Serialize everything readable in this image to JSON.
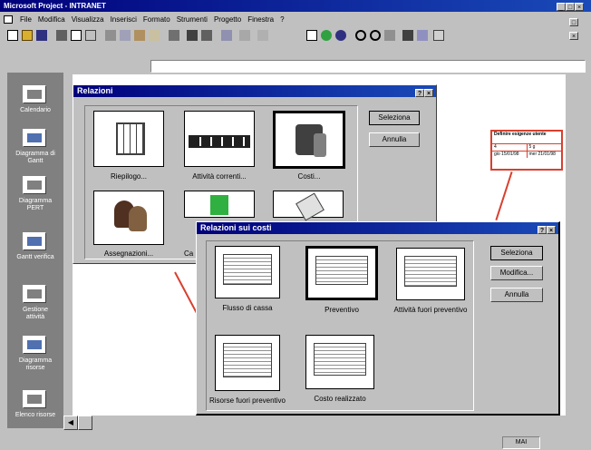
{
  "window": {
    "title": "Microsoft Project - INTRANET",
    "controls": [
      "_",
      "□",
      "×"
    ]
  },
  "menu": [
    {
      "label": "File",
      "u": "F"
    },
    {
      "label": "Modifica",
      "u": "M"
    },
    {
      "label": "Visualizza",
      "u": "V"
    },
    {
      "label": "Inserisci",
      "u": "I"
    },
    {
      "label": "Formato",
      "u": "o"
    },
    {
      "label": "Strumenti",
      "u": "S"
    },
    {
      "label": "Progetto",
      "u": "P"
    },
    {
      "label": "Finestra",
      "u": "n"
    },
    {
      "label": "?",
      "u": "?"
    }
  ],
  "viewbar": [
    {
      "name": "calendario",
      "label": "Calendario"
    },
    {
      "name": "gantt",
      "label": "Diagramma di Gantt"
    },
    {
      "name": "pert",
      "label": "Diagramma PERT"
    },
    {
      "name": "gantt-verifica",
      "label": "Gantt verifica"
    },
    {
      "name": "gestione-attivita",
      "label": "Gestione attività"
    },
    {
      "name": "diagramma-risorse",
      "label": "Diagramma risorse"
    },
    {
      "name": "elenco-risorse",
      "label": "Elenco risorse"
    }
  ],
  "pert_box": {
    "title": "Definire esigenze utente",
    "row1": [
      "4",
      "5 g"
    ],
    "row2": [
      "gio 15/01/98",
      "mer 21/01/98"
    ]
  },
  "relazioni": {
    "title": "Relazioni",
    "help": "?",
    "close": "×",
    "buttons": {
      "select": "Seleziona",
      "cancel": "Annulla"
    },
    "items": [
      {
        "label": "Riepilogo...",
        "icon": "calendar-grid-icon"
      },
      {
        "label": "Attività correnti...",
        "icon": "film-strip-icon"
      },
      {
        "label": "Costi...",
        "icon": "coin-stack-icon"
      },
      {
        "label": "Assegnazioni...",
        "icon": "people-icon"
      },
      {
        "label": "Ca",
        "icon": "blocks-icon"
      },
      {
        "label": "",
        "icon": "documents-icon"
      }
    ]
  },
  "costi": {
    "title": "Relazioni sui costi",
    "help": "?",
    "close": "×",
    "buttons": {
      "select": "Seleziona",
      "modify": "Modifica...",
      "cancel": "Annulla"
    },
    "items": [
      {
        "label": "Flusso di cassa"
      },
      {
        "label": "Preventivo"
      },
      {
        "label": "Attività fuori preventivo"
      },
      {
        "label": "Risorse fuori preventivo"
      },
      {
        "label": "Costo realizzato"
      }
    ]
  },
  "status": {
    "mode": "MAI"
  },
  "colors": {
    "title_blue": "#00007b",
    "red_line": "#d84030",
    "face": "#c0c0c0",
    "viewbar": "#808080"
  }
}
